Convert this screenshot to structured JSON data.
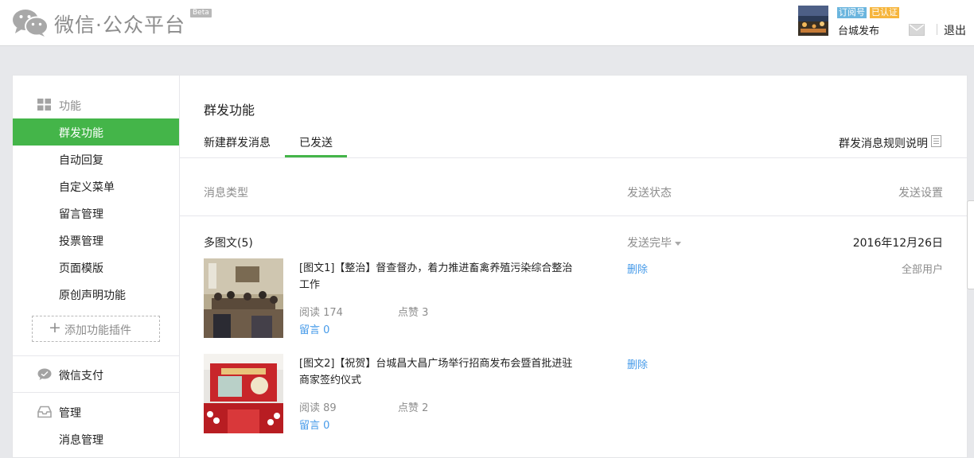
{
  "header": {
    "logo_icon": "wechat-logo-icon",
    "brand": "微信·公众平台",
    "beta": "Beta",
    "account": {
      "type_badge": "订阅号",
      "verified_badge": "已认证",
      "name": "台城发布"
    },
    "mail_icon": "mail-icon",
    "logout": "退出"
  },
  "sidebar": {
    "groups": [
      {
        "label": "功能",
        "icon": "grid-icon",
        "items": [
          "群发功能",
          "自动回复",
          "自定义菜单",
          "留言管理",
          "投票管理",
          "页面模版",
          "原创声明功能"
        ]
      },
      {
        "label": "微信支付",
        "icon": "chat-bubble-icon",
        "items": []
      },
      {
        "label": "管理",
        "icon": "inbox-icon",
        "items": [
          "消息管理"
        ]
      }
    ],
    "active_item": "群发功能",
    "add_plugin": "添加功能插件"
  },
  "main": {
    "title": "群发功能",
    "tabs": [
      "新建群发消息",
      "已发送"
    ],
    "active_tab": "已发送",
    "rules_link": "群发消息规则说明",
    "table_headers": [
      "消息类型",
      "发送状态",
      "发送设置"
    ],
    "group": {
      "type": "多图文(5)",
      "status": "发送完毕",
      "date": "2016年12月26日",
      "recipients": "全部用户",
      "articles": [
        {
          "title": "[图文1]【整治】督查督办，着力推进畜禽养殖污染综合整治工作",
          "read": "阅读 174",
          "likes": "点赞 3",
          "comments": "留言 0",
          "delete": "删除"
        },
        {
          "title": "[图文2]【祝贺】台城昌大昌广场举行招商发布会暨首批进驻商家签约仪式",
          "read": "阅读 89",
          "likes": "点赞 2",
          "comments": "留言 0",
          "delete": "删除"
        }
      ]
    }
  },
  "colors": {
    "accent": "#44b549",
    "link": "#459ae9",
    "badge_subscription": "#6bb5de",
    "badge_verified": "#f6b53c"
  }
}
